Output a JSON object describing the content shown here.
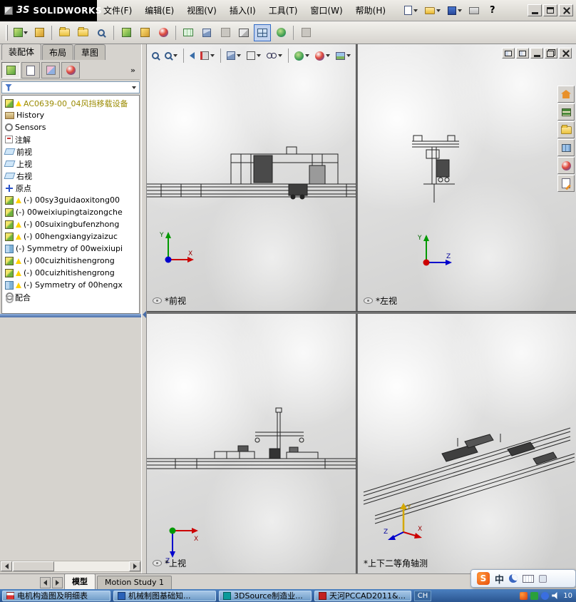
{
  "titlebar": {
    "logo_mark": "3S",
    "logo_text": "SOLIDWORKS",
    "menus": [
      "文件(F)",
      "编辑(E)",
      "视图(V)",
      "插入(I)",
      "工具(T)",
      "窗口(W)",
      "帮助(H)"
    ],
    "help": "?"
  },
  "command_tabs": [
    {
      "label": "装配体"
    },
    {
      "label": "布局"
    },
    {
      "label": "草图"
    }
  ],
  "panel": {
    "more": "»"
  },
  "tree": {
    "root_label": "AC0639-00_04风挡移载设备",
    "items": [
      {
        "label": "History"
      },
      {
        "label": "Sensors"
      },
      {
        "label": "注解"
      },
      {
        "label": "前视"
      },
      {
        "label": "上视"
      },
      {
        "label": "右视"
      },
      {
        "label": "原点"
      },
      {
        "label": "(-) 00sy3guidaoxitong00"
      },
      {
        "label": "(-) 00weixiupingtaizongche"
      },
      {
        "label": "(-) 00suixingbufenzhong"
      },
      {
        "label": "(-) 00hengxiangyizaizuc"
      },
      {
        "label": "(-) Symmetry of 00weixiupi"
      },
      {
        "label": "(-) 00cuizhitishengrong"
      },
      {
        "label": "(-) 00cuizhitishengrong"
      },
      {
        "label": "(-) Symmetry of 00hengx"
      },
      {
        "label": "配合"
      }
    ]
  },
  "viewports": [
    {
      "label": "*前视"
    },
    {
      "label": "*左视"
    },
    {
      "label": "*上视"
    },
    {
      "label": "*上下二等角轴测"
    }
  ],
  "axes": {
    "x": "X",
    "y": "Y",
    "z": "Z"
  },
  "bottom_tabs": [
    {
      "label": "模型"
    },
    {
      "label": "Motion Study 1"
    }
  ],
  "language_bar": {
    "sogou": "S",
    "chinese": "中"
  },
  "taskbar": {
    "buttons": [
      {
        "label": "电机构造图及明细表"
      },
      {
        "label": "机械制图基础知..."
      },
      {
        "label": "3DSource制造业..."
      },
      {
        "label": "天河PCCAD2011&..."
      }
    ],
    "language": "CH",
    "clock": "10"
  }
}
